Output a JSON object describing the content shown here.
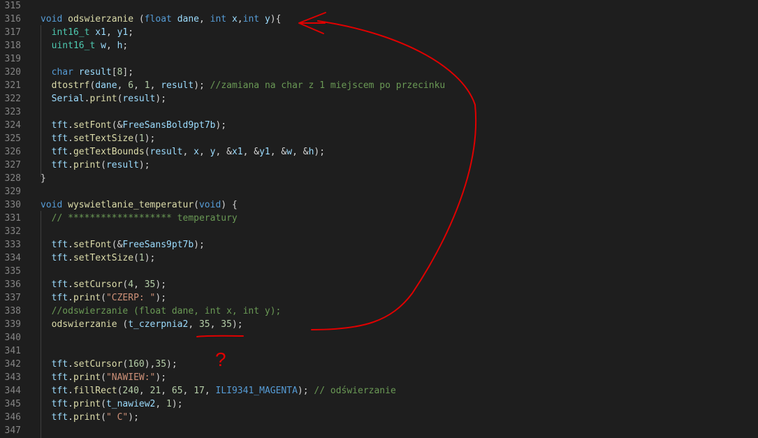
{
  "colors": {
    "background": "#1e1e1e",
    "line_number": "#858585",
    "keyword": "#569cd6",
    "type": "#4ec9b0",
    "function": "#dcdcaa",
    "variable": "#9cdcfe",
    "number": "#b5cea8",
    "string": "#ce9178",
    "comment": "#6a9955",
    "annotation": "#e00000"
  },
  "annotation": {
    "mark": "?"
  },
  "lines": [
    {
      "n": "315",
      "tokens": []
    },
    {
      "n": "316",
      "tokens": [
        [
          "kw",
          "void"
        ],
        [
          "pl",
          " "
        ],
        [
          "fn",
          "odswierzanie"
        ],
        [
          "pl",
          " ("
        ],
        [
          "kw",
          "float"
        ],
        [
          "pl",
          " "
        ],
        [
          "va",
          "dane"
        ],
        [
          "pl",
          ", "
        ],
        [
          "kw",
          "int"
        ],
        [
          "pl",
          " "
        ],
        [
          "va",
          "x"
        ],
        [
          "pl",
          ","
        ],
        [
          "kw",
          "int"
        ],
        [
          "pl",
          " "
        ],
        [
          "va",
          "y"
        ],
        [
          "pl",
          "){"
        ]
      ]
    },
    {
      "n": "317",
      "tokens": [
        [
          "pl",
          "  "
        ],
        [
          "ty",
          "int16_t"
        ],
        [
          "pl",
          " "
        ],
        [
          "va",
          "x1"
        ],
        [
          "pl",
          ", "
        ],
        [
          "va",
          "y1"
        ],
        [
          "pl",
          ";"
        ]
      ]
    },
    {
      "n": "318",
      "tokens": [
        [
          "pl",
          "  "
        ],
        [
          "ty",
          "uint16_t"
        ],
        [
          "pl",
          " "
        ],
        [
          "va",
          "w"
        ],
        [
          "pl",
          ", "
        ],
        [
          "va",
          "h"
        ],
        [
          "pl",
          ";"
        ]
      ]
    },
    {
      "n": "319",
      "tokens": []
    },
    {
      "n": "320",
      "tokens": [
        [
          "pl",
          "  "
        ],
        [
          "kw",
          "char"
        ],
        [
          "pl",
          " "
        ],
        [
          "va",
          "result"
        ],
        [
          "pl",
          "["
        ],
        [
          "nu",
          "8"
        ],
        [
          "pl",
          "];"
        ]
      ]
    },
    {
      "n": "321",
      "tokens": [
        [
          "pl",
          "  "
        ],
        [
          "fn",
          "dtostrf"
        ],
        [
          "pl",
          "("
        ],
        [
          "va",
          "dane"
        ],
        [
          "pl",
          ", "
        ],
        [
          "nu",
          "6"
        ],
        [
          "pl",
          ", "
        ],
        [
          "nu",
          "1"
        ],
        [
          "pl",
          ", "
        ],
        [
          "va",
          "result"
        ],
        [
          "pl",
          "); "
        ],
        [
          "cm",
          "//zamiana na char z 1 miejscem po przecinku"
        ]
      ]
    },
    {
      "n": "322",
      "tokens": [
        [
          "pl",
          "  "
        ],
        [
          "va",
          "Serial"
        ],
        [
          "pl",
          "."
        ],
        [
          "fn",
          "print"
        ],
        [
          "pl",
          "("
        ],
        [
          "va",
          "result"
        ],
        [
          "pl",
          ");"
        ]
      ]
    },
    {
      "n": "323",
      "tokens": []
    },
    {
      "n": "324",
      "tokens": [
        [
          "pl",
          "  "
        ],
        [
          "va",
          "tft"
        ],
        [
          "pl",
          "."
        ],
        [
          "fn",
          "setFont"
        ],
        [
          "pl",
          "(&"
        ],
        [
          "va",
          "FreeSansBold9pt7b"
        ],
        [
          "pl",
          ");"
        ]
      ]
    },
    {
      "n": "325",
      "tokens": [
        [
          "pl",
          "  "
        ],
        [
          "va",
          "tft"
        ],
        [
          "pl",
          "."
        ],
        [
          "fn",
          "setTextSize"
        ],
        [
          "pl",
          "("
        ],
        [
          "nu",
          "1"
        ],
        [
          "pl",
          ");"
        ]
      ]
    },
    {
      "n": "326",
      "tokens": [
        [
          "pl",
          "  "
        ],
        [
          "va",
          "tft"
        ],
        [
          "pl",
          "."
        ],
        [
          "fn",
          "getTextBounds"
        ],
        [
          "pl",
          "("
        ],
        [
          "va",
          "result"
        ],
        [
          "pl",
          ", "
        ],
        [
          "va",
          "x"
        ],
        [
          "pl",
          ", "
        ],
        [
          "va",
          "y"
        ],
        [
          "pl",
          ", &"
        ],
        [
          "va",
          "x1"
        ],
        [
          "pl",
          ", &"
        ],
        [
          "va",
          "y1"
        ],
        [
          "pl",
          ", &"
        ],
        [
          "va",
          "w"
        ],
        [
          "pl",
          ", &"
        ],
        [
          "va",
          "h"
        ],
        [
          "pl",
          ");"
        ]
      ]
    },
    {
      "n": "327",
      "tokens": [
        [
          "pl",
          "  "
        ],
        [
          "va",
          "tft"
        ],
        [
          "pl",
          "."
        ],
        [
          "fn",
          "print"
        ],
        [
          "pl",
          "("
        ],
        [
          "va",
          "result"
        ],
        [
          "pl",
          ");"
        ]
      ]
    },
    {
      "n": "328",
      "tokens": [
        [
          "pl",
          "}"
        ]
      ]
    },
    {
      "n": "329",
      "tokens": []
    },
    {
      "n": "330",
      "tokens": [
        [
          "kw",
          "void"
        ],
        [
          "pl",
          " "
        ],
        [
          "fn",
          "wyswietlanie_temperatur"
        ],
        [
          "pl",
          "("
        ],
        [
          "kw",
          "void"
        ],
        [
          "pl",
          ") {"
        ]
      ]
    },
    {
      "n": "331",
      "tokens": [
        [
          "pl",
          "  "
        ],
        [
          "cm",
          "// ******************* temperatury"
        ]
      ]
    },
    {
      "n": "332",
      "tokens": []
    },
    {
      "n": "333",
      "tokens": [
        [
          "pl",
          "  "
        ],
        [
          "va",
          "tft"
        ],
        [
          "pl",
          "."
        ],
        [
          "fn",
          "setFont"
        ],
        [
          "pl",
          "(&"
        ],
        [
          "va",
          "FreeSans9pt7b"
        ],
        [
          "pl",
          ");"
        ]
      ]
    },
    {
      "n": "334",
      "tokens": [
        [
          "pl",
          "  "
        ],
        [
          "va",
          "tft"
        ],
        [
          "pl",
          "."
        ],
        [
          "fn",
          "setTextSize"
        ],
        [
          "pl",
          "("
        ],
        [
          "nu",
          "1"
        ],
        [
          "pl",
          ");"
        ]
      ]
    },
    {
      "n": "335",
      "tokens": []
    },
    {
      "n": "336",
      "tokens": [
        [
          "pl",
          "  "
        ],
        [
          "va",
          "tft"
        ],
        [
          "pl",
          "."
        ],
        [
          "fn",
          "setCursor"
        ],
        [
          "pl",
          "("
        ],
        [
          "nu",
          "4"
        ],
        [
          "pl",
          ", "
        ],
        [
          "nu",
          "35"
        ],
        [
          "pl",
          ");"
        ]
      ]
    },
    {
      "n": "337",
      "tokens": [
        [
          "pl",
          "  "
        ],
        [
          "va",
          "tft"
        ],
        [
          "pl",
          "."
        ],
        [
          "fn",
          "print"
        ],
        [
          "pl",
          "("
        ],
        [
          "st",
          "\"CZERP: \""
        ],
        [
          "pl",
          ");"
        ]
      ]
    },
    {
      "n": "338",
      "tokens": [
        [
          "pl",
          "  "
        ],
        [
          "cm",
          "//odswierzanie (float dane, int x, int y);"
        ]
      ]
    },
    {
      "n": "339",
      "tokens": [
        [
          "pl",
          "  "
        ],
        [
          "fn",
          "odswierzanie"
        ],
        [
          "pl",
          " ("
        ],
        [
          "va",
          "t_czerpnia2"
        ],
        [
          "pl",
          ", "
        ],
        [
          "nu",
          "35"
        ],
        [
          "pl",
          ", "
        ],
        [
          "nu",
          "35"
        ],
        [
          "pl",
          ");"
        ]
      ]
    },
    {
      "n": "340",
      "tokens": []
    },
    {
      "n": "341",
      "tokens": []
    },
    {
      "n": "342",
      "tokens": [
        [
          "pl",
          "  "
        ],
        [
          "va",
          "tft"
        ],
        [
          "pl",
          "."
        ],
        [
          "fn",
          "setCursor"
        ],
        [
          "pl",
          "("
        ],
        [
          "nu",
          "160"
        ],
        [
          "pl",
          "),"
        ],
        [
          "nu",
          "35"
        ],
        [
          "pl",
          ");"
        ]
      ]
    },
    {
      "n": "343",
      "tokens": [
        [
          "pl",
          "  "
        ],
        [
          "va",
          "tft"
        ],
        [
          "pl",
          "."
        ],
        [
          "fn",
          "print"
        ],
        [
          "pl",
          "("
        ],
        [
          "st",
          "\"NAWIEW:\""
        ],
        [
          "pl",
          ");"
        ]
      ]
    },
    {
      "n": "344",
      "tokens": [
        [
          "pl",
          "  "
        ],
        [
          "va",
          "tft"
        ],
        [
          "pl",
          "."
        ],
        [
          "fn",
          "fillRect"
        ],
        [
          "pl",
          "("
        ],
        [
          "nu",
          "240"
        ],
        [
          "pl",
          ", "
        ],
        [
          "nu",
          "21"
        ],
        [
          "pl",
          ", "
        ],
        [
          "nu",
          "65"
        ],
        [
          "pl",
          ", "
        ],
        [
          "nu",
          "17"
        ],
        [
          "pl",
          ", "
        ],
        [
          "kw",
          "ILI9341_MAGENTA"
        ],
        [
          "pl",
          "); "
        ],
        [
          "cm",
          "// odświerzanie"
        ]
      ]
    },
    {
      "n": "345",
      "tokens": [
        [
          "pl",
          "  "
        ],
        [
          "va",
          "tft"
        ],
        [
          "pl",
          "."
        ],
        [
          "fn",
          "print"
        ],
        [
          "pl",
          "("
        ],
        [
          "va",
          "t_nawiew2"
        ],
        [
          "pl",
          ", "
        ],
        [
          "nu",
          "1"
        ],
        [
          "pl",
          ");"
        ]
      ]
    },
    {
      "n": "346",
      "tokens": [
        [
          "pl",
          "  "
        ],
        [
          "va",
          "tft"
        ],
        [
          "pl",
          "."
        ],
        [
          "fn",
          "print"
        ],
        [
          "pl",
          "("
        ],
        [
          "st",
          "\" C\""
        ],
        [
          "pl",
          ");"
        ]
      ]
    },
    {
      "n": "347",
      "tokens": []
    }
  ]
}
